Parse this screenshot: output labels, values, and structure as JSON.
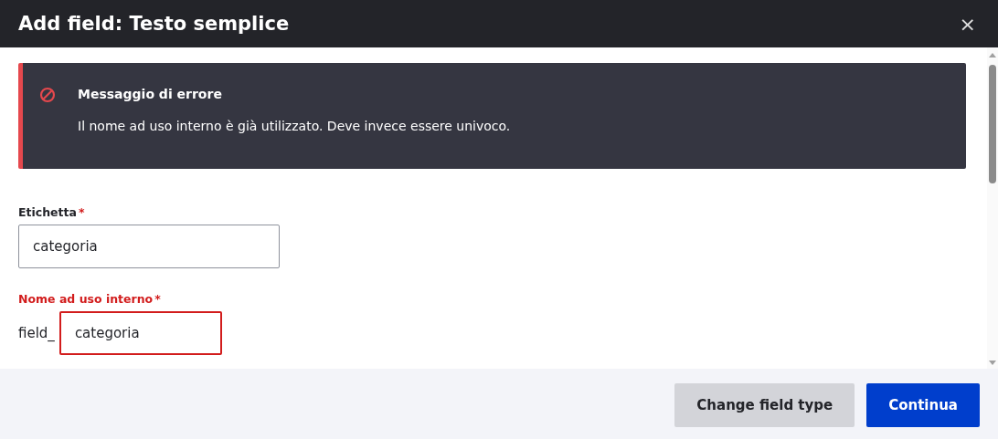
{
  "dialog": {
    "title": "Add field: Testo semplice",
    "close": "×"
  },
  "error": {
    "title": "Messaggio di errore",
    "message": "Il nome ad uso interno è già utilizzato. Deve invece essere univoco."
  },
  "fields": [
    {
      "kind": "text",
      "label": "Etichetta",
      "required_mark": "*",
      "value": "categoria",
      "invalid": false
    },
    {
      "kind": "prefixed",
      "label": "Nome ad uso interno",
      "required_mark": "*",
      "prefix": "field_",
      "value": "categoria",
      "invalid": true
    }
  ],
  "buttons": [
    {
      "label": "Change field type",
      "primary": false
    },
    {
      "label": "Continua",
      "primary": true
    }
  ]
}
